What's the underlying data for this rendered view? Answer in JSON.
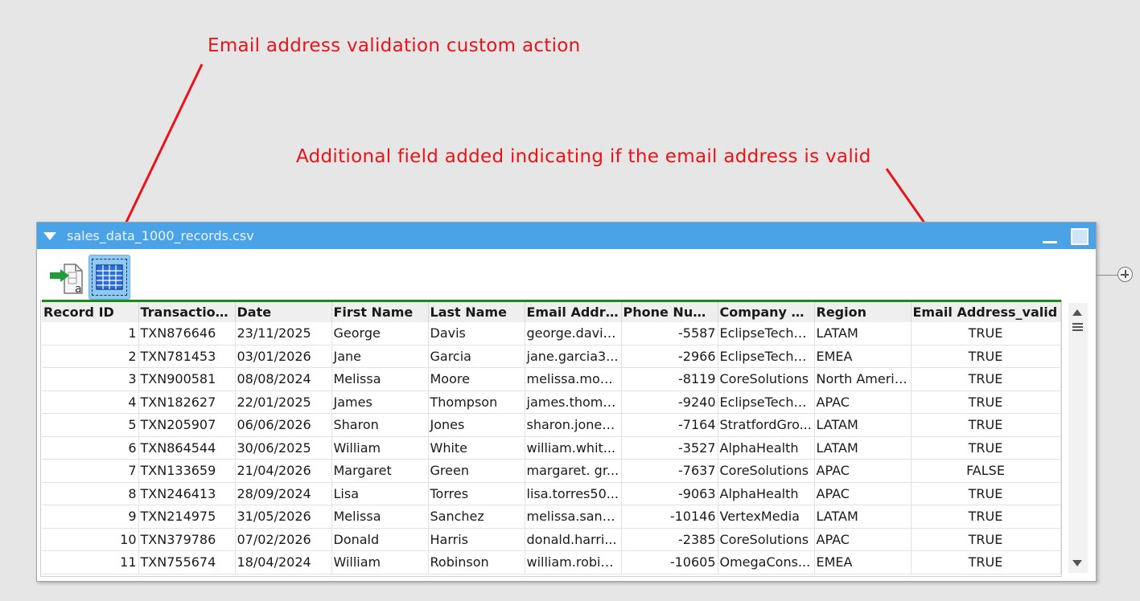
{
  "annotations": {
    "custom_action": "Email address validation custom action",
    "new_field": "Additional field added indicating if the email address is valid"
  },
  "window": {
    "title": "sales_data_1000_records.csv",
    "accent_color": "#4aa3e6",
    "header_rule_color": "#1a8c1a"
  },
  "toolbar": {
    "export_icon": "export-to-table-icon",
    "grid_icon": "table-grid-icon"
  },
  "table": {
    "columns": [
      "Record ID",
      "Transaction ID",
      "Date",
      "First Name",
      "Last Name",
      "Email Address",
      "Phone Num...",
      "Company N...",
      "Region",
      "Email Address_valid"
    ],
    "rows": [
      [
        "1",
        "TXN876646",
        "23/11/2025",
        "George",
        "Davis",
        "george.davis...",
        "-5587",
        "EclipseTechn...",
        "LATAM",
        "TRUE"
      ],
      [
        "2",
        "TXN781453",
        "03/01/2026",
        "Jane",
        "Garcia",
        "jane.garcia3...",
        "-2966",
        "EclipseTechn...",
        "EMEA",
        "TRUE"
      ],
      [
        "3",
        "TXN900581",
        "08/08/2024",
        "Melissa",
        "Moore",
        "melissa.moor...",
        "-8119",
        "CoreSolutions",
        "North America",
        "TRUE"
      ],
      [
        "4",
        "TXN182627",
        "22/01/2025",
        "James",
        "Thompson",
        "james.thomp...",
        "-9240",
        "EclipseTechn...",
        "APAC",
        "TRUE"
      ],
      [
        "5",
        "TXN205907",
        "06/06/2026",
        "Sharon",
        "Jones",
        "sharon.jones...",
        "-7164",
        "StratfordGro...",
        "LATAM",
        "TRUE"
      ],
      [
        "6",
        "TXN864544",
        "30/06/2025",
        "William",
        "White",
        "william.whit...",
        "-3527",
        "AlphaHealth",
        "LATAM",
        "TRUE"
      ],
      [
        "7",
        "TXN133659",
        "21/04/2026",
        "Margaret",
        "Green",
        "margaret. gr...",
        "-7637",
        "CoreSolutions",
        "APAC",
        "FALSE"
      ],
      [
        "8",
        "TXN246413",
        "28/09/2024",
        "Lisa",
        "Torres",
        "lisa.torres50...",
        "-9063",
        "AlphaHealth",
        "APAC",
        "TRUE"
      ],
      [
        "9",
        "TXN214975",
        "31/05/2026",
        "Melissa",
        "Sanchez",
        "melissa.sanc...",
        "-10146",
        "VertexMedia",
        "LATAM",
        "TRUE"
      ],
      [
        "10",
        "TXN379786",
        "07/02/2026",
        "Donald",
        "Harris",
        "donald.harri...",
        "-2385",
        "CoreSolutions",
        "APAC",
        "TRUE"
      ],
      [
        "11",
        "TXN755674",
        "18/04/2024",
        "William",
        "Robinson",
        "william.robin...",
        "-10605",
        "OmegaCons...",
        "EMEA",
        "TRUE"
      ]
    ]
  }
}
